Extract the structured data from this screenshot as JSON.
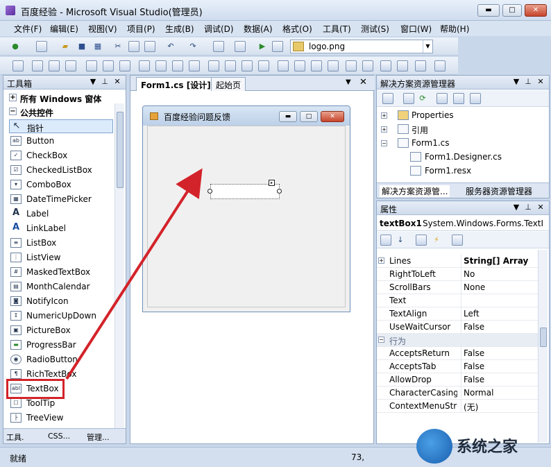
{
  "window": {
    "title": "百度经验 - Microsoft Visual Studio(管理员)",
    "min_symbol": "▬",
    "max_symbol": "□",
    "close_symbol": "✕"
  },
  "menu": [
    "文件(F)",
    "编辑(E)",
    "视图(V)",
    "项目(P)",
    "生成(B)",
    "调试(D)",
    "数据(A)",
    "格式(O)",
    "工具(T)",
    "测试(S)",
    "窗口(W)",
    "帮助(H)"
  ],
  "toolbar": {
    "file_combo_value": "logo.png",
    "icons": [
      "new-project-icon",
      "add-item-icon",
      "open-icon",
      "save-icon",
      "save-all-icon",
      "cut-icon",
      "copy-icon",
      "paste-icon",
      "undo-icon",
      "redo-icon",
      "navigate-back-icon",
      "navigate-forward-icon",
      "start-debug-icon",
      "find-icon"
    ]
  },
  "toolbox": {
    "title": "工具箱",
    "categories": [
      {
        "expander": "+",
        "label": "所有 Windows 窗体"
      },
      {
        "expander": "−",
        "label": "公共控件"
      }
    ],
    "items": [
      {
        "label": "指针",
        "icon": "pointer-icon",
        "glyph": "↖"
      },
      {
        "label": "Button",
        "icon": "button-icon",
        "glyph": "ab"
      },
      {
        "label": "CheckBox",
        "icon": "checkbox-icon",
        "glyph": "✓"
      },
      {
        "label": "CheckedListBox",
        "icon": "checkedlistbox-icon",
        "glyph": "☑"
      },
      {
        "label": "ComboBox",
        "icon": "combobox-icon",
        "glyph": "▾"
      },
      {
        "label": "DateTimePicker",
        "icon": "datetimepicker-icon",
        "glyph": "▦"
      },
      {
        "label": "Label",
        "icon": "label-icon",
        "glyph": "A"
      },
      {
        "label": "LinkLabel",
        "icon": "linklabel-icon",
        "glyph": "A"
      },
      {
        "label": "ListBox",
        "icon": "listbox-icon",
        "glyph": "≡"
      },
      {
        "label": "ListView",
        "icon": "listview-icon",
        "glyph": "⋮"
      },
      {
        "label": "MaskedTextBox",
        "icon": "maskedtextbox-icon",
        "glyph": "#"
      },
      {
        "label": "MonthCalendar",
        "icon": "monthcalendar-icon",
        "glyph": "▤"
      },
      {
        "label": "NotifyIcon",
        "icon": "notifyicon-icon",
        "glyph": "◙"
      },
      {
        "label": "NumericUpDown",
        "icon": "numericupdown-icon",
        "glyph": "↕"
      },
      {
        "label": "PictureBox",
        "icon": "picturebox-icon",
        "glyph": "▣"
      },
      {
        "label": "ProgressBar",
        "icon": "progressbar-icon",
        "glyph": "▬"
      },
      {
        "label": "RadioButton",
        "icon": "radiobutton-icon",
        "glyph": "◉"
      },
      {
        "label": "RichTextBox",
        "icon": "richtextbox-icon",
        "glyph": "¶"
      },
      {
        "label": "TextBox",
        "icon": "textbox-icon",
        "glyph": "abl"
      },
      {
        "label": "ToolTip",
        "icon": "tooltip-icon",
        "glyph": "☐"
      },
      {
        "label": "TreeView",
        "icon": "treeview-icon",
        "glyph": "├"
      }
    ],
    "selected_item": "指针",
    "highlighted_item": "TextBox",
    "bottom_tabs": [
      "工具.",
      "CSS...",
      "管理..."
    ]
  },
  "designer": {
    "tabs": [
      "Form1.cs [设计]*",
      "起始页"
    ],
    "active_tab": "Form1.cs [设计]*",
    "form_title": "百度经验问题反馈",
    "close_symbol": "✕",
    "dropdown_symbol": "▼"
  },
  "solution_explorer": {
    "title": "解决方案资源管理器",
    "tree": [
      {
        "label": "Properties",
        "expander": "+",
        "icon": "properties-folder-icon"
      },
      {
        "label": "引用",
        "expander": "+",
        "icon": "references-icon"
      },
      {
        "label": "Form1.cs",
        "expander": "−",
        "icon": "form-file-icon"
      },
      {
        "label": "Form1.Designer.cs",
        "icon": "cs-file-icon"
      },
      {
        "label": "Form1.resx",
        "icon": "resx-file-icon"
      }
    ],
    "bottom_tabs": [
      "解决方案资源管...",
      "服务器资源管理器"
    ]
  },
  "properties": {
    "title": "属性",
    "object_name": "textBox1",
    "object_type": "System.Windows.Forms.TextI",
    "rows": [
      {
        "name": "Lines",
        "value": "String[] Array",
        "expander": "+",
        "bold": true
      },
      {
        "name": "RightToLeft",
        "value": "No"
      },
      {
        "name": "ScrollBars",
        "value": "None"
      },
      {
        "name": "Text",
        "value": ""
      },
      {
        "name": "TextAlign",
        "value": "Left"
      },
      {
        "name": "UseWaitCursor",
        "value": "False"
      },
      {
        "name": "行为",
        "value": "",
        "section": true,
        "expander": "−"
      },
      {
        "name": "AcceptsReturn",
        "value": "False"
      },
      {
        "name": "AcceptsTab",
        "value": "False"
      },
      {
        "name": "AllowDrop",
        "value": "False"
      },
      {
        "name": "CharacterCasing",
        "value": "Normal"
      },
      {
        "name": "ContextMenuStrip",
        "value": "(无)"
      }
    ]
  },
  "status": {
    "text": "就绪",
    "coordinates": "73,"
  },
  "watermark": {
    "text": "系统之家"
  },
  "colors": {
    "annotation_red": "#d3232a",
    "selected_item_bg": "#dcebfc"
  }
}
